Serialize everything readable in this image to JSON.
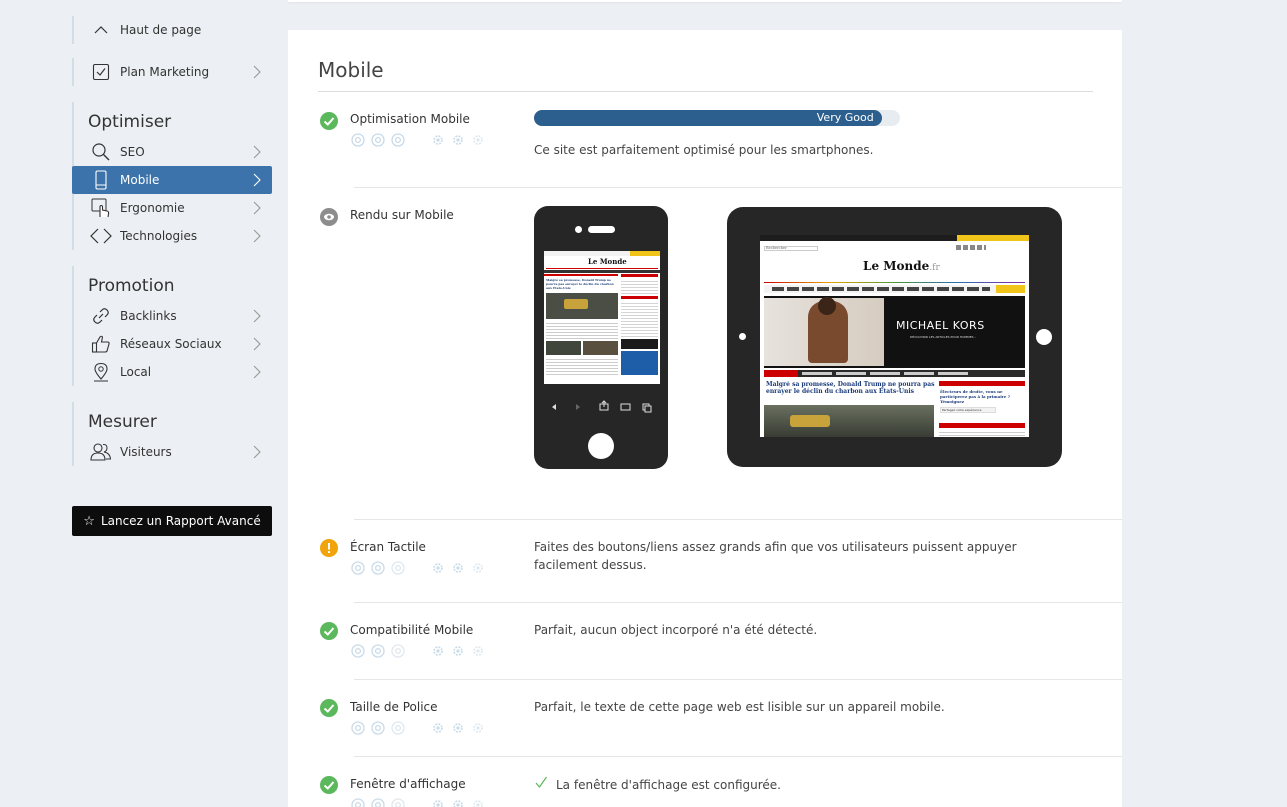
{
  "sidebar": {
    "back_top": "Haut de page",
    "plan_marketing": "Plan Marketing",
    "groups": [
      {
        "title": "Optimiser",
        "items": [
          {
            "label": "SEO",
            "icon": "search-icon"
          },
          {
            "label": "Mobile",
            "icon": "mobile-icon",
            "active": true
          },
          {
            "label": "Ergonomie",
            "icon": "touch-icon"
          },
          {
            "label": "Technologies",
            "icon": "code-icon"
          }
        ]
      },
      {
        "title": "Promotion",
        "items": [
          {
            "label": "Backlinks",
            "icon": "link-icon"
          },
          {
            "label": "Réseaux Sociaux",
            "icon": "thumbs-up-icon"
          },
          {
            "label": "Local",
            "icon": "map-pin-icon"
          }
        ]
      },
      {
        "title": "Mesurer",
        "items": [
          {
            "label": "Visiteurs",
            "icon": "users-icon"
          }
        ]
      }
    ],
    "cta": "Lancez un Rapport Avancé"
  },
  "main": {
    "title": "Mobile",
    "criteria": [
      {
        "label": "Optimisation Mobile",
        "status": "ok",
        "bar_label": "Very Good",
        "bar_value_pct": 95,
        "text": "Ce site est parfaitement optimisé pour les smartphones."
      },
      {
        "label": "Rendu sur Mobile",
        "status": "neutral",
        "text": ""
      },
      {
        "label": "Écran Tactile",
        "status": "warn",
        "text": "Faites des boutons/liens assez grands afin que vos utilisateurs puissent appuyer facilement dessus."
      },
      {
        "label": "Compatibilité Mobile",
        "status": "ok",
        "text": "Parfait, aucun object incorporé n'a été détecté."
      },
      {
        "label": "Taille de Police",
        "status": "ok",
        "text": "Parfait, le texte de cette page web est lisible sur un appareil mobile."
      },
      {
        "label": "Fenêtre d'affichage",
        "status": "ok",
        "text": "La fenêtre d'affichage est configurée."
      }
    ],
    "preview": {
      "logo": "Le Monde",
      "logo_suffix": ".fr",
      "ad_brand": "MICHAEL KORS",
      "ad_sub": "DÉCOUVRIR LES ARTICLES POUR HOMMES ›",
      "headline_phone": "Malgré sa promesse, Donald Trump ne pourra pas enrayer le déclin du charbon aux États-Unis",
      "headline_tablet": "Malgré sa promesse, Donald Trump ne pourra pas enrayer le déclin du charbon aux États-Unis",
      "side_headline": "Électeurs de droite, vous ne participerez pas à la primaire ? Témoignez",
      "side_button": "Partagez votre expérience",
      "search_placeholder": "Rechercher"
    }
  }
}
